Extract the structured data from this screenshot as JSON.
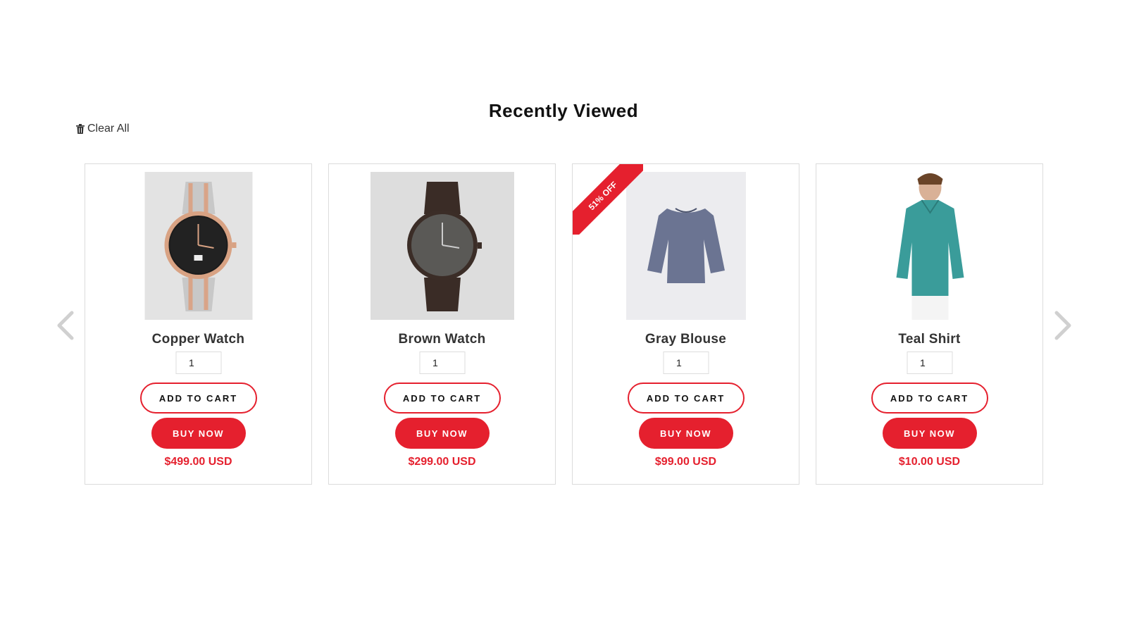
{
  "section_title": "Recently Viewed",
  "clear_all_label": "Clear All",
  "accent_color": "#e5202e",
  "icons": {
    "clear": "trash-icon",
    "prev": "chevron-left-icon",
    "next": "chevron-right-icon"
  },
  "products": [
    {
      "name": "Copper Watch",
      "quantity": "1",
      "add_to_cart": "ADD TO CART",
      "buy_now": "BUY NOW",
      "price": "$499.00 USD",
      "badge": ""
    },
    {
      "name": "Brown Watch",
      "quantity": "1",
      "add_to_cart": "ADD TO CART",
      "buy_now": "BUY NOW",
      "price": "$299.00 USD",
      "badge": ""
    },
    {
      "name": "Gray Blouse",
      "quantity": "1",
      "add_to_cart": "ADD TO CART",
      "buy_now": "BUY NOW",
      "price": "$99.00 USD",
      "badge": "51% OFF"
    },
    {
      "name": "Teal Shirt",
      "quantity": "1",
      "add_to_cart": "ADD TO CART",
      "buy_now": "BUY NOW",
      "price": "$10.00 USD",
      "badge": ""
    }
  ]
}
